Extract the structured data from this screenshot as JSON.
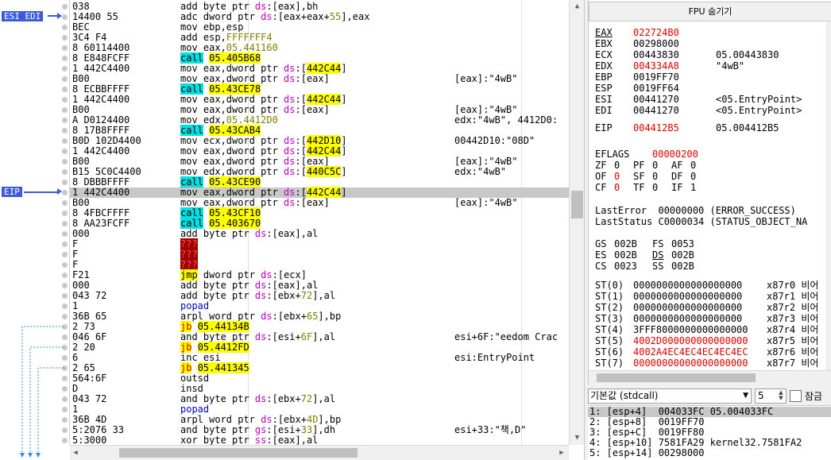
{
  "disasm": {
    "labels": {
      "esi_edi": "ESI EDI",
      "eip": "EIP"
    },
    "rows": [
      {
        "addr": "038",
        "ins": [
          [
            "mn",
            "add byte ptr "
          ],
          [
            "seg",
            "ds"
          ],
          [
            "mn",
            ":[eax],bh"
          ]
        ],
        "cmt": ""
      },
      {
        "addr": "14400 55",
        "ins": [
          [
            "mn",
            "adc dword ptr "
          ],
          [
            "seg",
            "ds"
          ],
          [
            "mn",
            ":[eax+eax+"
          ],
          [
            "num",
            "55"
          ],
          [
            "mn",
            "],eax"
          ]
        ],
        "cmt": ""
      },
      {
        "addr": "BEC",
        "ins": [
          [
            "mn",
            "mov ebp,esp"
          ]
        ],
        "cmt": ""
      },
      {
        "addr": "3C4 F4",
        "ins": [
          [
            "mn",
            "add esp,"
          ],
          [
            "num",
            "FFFFFFF4"
          ]
        ],
        "cmt": ""
      },
      {
        "addr": "8 60114400",
        "ins": [
          [
            "mn",
            "mov eax,"
          ],
          [
            "num",
            "05.441160"
          ]
        ],
        "cmt": ""
      },
      {
        "addr": "8 E848FCFF",
        "ins": [
          [
            "call",
            "call"
          ],
          [
            "mn",
            " "
          ],
          [
            "tgt",
            "05.405B68"
          ]
        ],
        "cmt": ""
      },
      {
        "addr": "1 442C4400",
        "ins": [
          [
            "mn",
            "mov eax,dword ptr "
          ],
          [
            "seg",
            "ds"
          ],
          [
            "mn",
            ":["
          ],
          [
            "tgt",
            "442C44"
          ],
          [
            "mn",
            "]"
          ]
        ],
        "cmt": ""
      },
      {
        "addr": "B00",
        "ins": [
          [
            "mn",
            "mov eax,dword ptr "
          ],
          [
            "seg",
            "ds"
          ],
          [
            "mn",
            ":[eax]"
          ]
        ],
        "cmt": "[eax]:\"4wB\""
      },
      {
        "addr": "8 ECBBFFFF",
        "ins": [
          [
            "call",
            "call"
          ],
          [
            "mn",
            " "
          ],
          [
            "tgt",
            "05.43CE78"
          ]
        ],
        "cmt": ""
      },
      {
        "addr": "1 442C4400",
        "ins": [
          [
            "mn",
            "mov eax,dword ptr "
          ],
          [
            "seg",
            "ds"
          ],
          [
            "mn",
            ":["
          ],
          [
            "tgt",
            "442C44"
          ],
          [
            "mn",
            "]"
          ]
        ],
        "cmt": ""
      },
      {
        "addr": "B00",
        "ins": [
          [
            "mn",
            "mov eax,dword ptr "
          ],
          [
            "seg",
            "ds"
          ],
          [
            "mn",
            ":[eax]"
          ]
        ],
        "cmt": "[eax]:\"4wB\""
      },
      {
        "addr": "A D0124400",
        "ins": [
          [
            "mn",
            "mov edx,"
          ],
          [
            "num",
            "05.4412D0"
          ]
        ],
        "cmt": "edx:\"4wB\", 4412D0:"
      },
      {
        "addr": "8 17B8FFFF",
        "ins": [
          [
            "call",
            "call"
          ],
          [
            "mn",
            " "
          ],
          [
            "tgt",
            "05.43CAB4"
          ]
        ],
        "cmt": ""
      },
      {
        "addr": "B0D 102D4400",
        "ins": [
          [
            "mn",
            "mov ecx,dword ptr "
          ],
          [
            "seg",
            "ds"
          ],
          [
            "mn",
            ":["
          ],
          [
            "tgt",
            "442D10"
          ],
          [
            "mn",
            "]"
          ]
        ],
        "cmt": "00442D10:\"08D\""
      },
      {
        "addr": "1 442C4400",
        "ins": [
          [
            "mn",
            "mov eax,dword ptr "
          ],
          [
            "seg",
            "ds"
          ],
          [
            "mn",
            ":["
          ],
          [
            "tgt",
            "442C44"
          ],
          [
            "mn",
            "]"
          ]
        ],
        "cmt": ""
      },
      {
        "addr": "B00",
        "ins": [
          [
            "mn",
            "mov eax,dword ptr "
          ],
          [
            "seg",
            "ds"
          ],
          [
            "mn",
            ":[eax]"
          ]
        ],
        "cmt": "[eax]:\"4wB\""
      },
      {
        "addr": "B15 5C0C4400",
        "ins": [
          [
            "mn",
            "mov edx,dword ptr "
          ],
          [
            "seg",
            "ds"
          ],
          [
            "mn",
            ":["
          ],
          [
            "tgt",
            "440C5C"
          ],
          [
            "mn",
            "]"
          ]
        ],
        "cmt": "edx:\"4wB\""
      },
      {
        "addr": "8 DBBBFFFF",
        "ins": [
          [
            "call",
            "call"
          ],
          [
            "mn",
            " "
          ],
          [
            "tgt",
            "05.43CE90"
          ]
        ],
        "cmt": ""
      },
      {
        "addr": "1 442C4400",
        "ins": [
          [
            "mn",
            "mov eax,dword ptr "
          ],
          [
            "seg",
            "ds"
          ],
          [
            "mn",
            ":["
          ],
          [
            "tgt",
            "442C44"
          ],
          [
            "mn",
            "]"
          ]
        ],
        "cmt": "",
        "eip": true
      },
      {
        "addr": "B00",
        "ins": [
          [
            "mn",
            "mov eax,dword ptr "
          ],
          [
            "seg",
            "ds"
          ],
          [
            "mn",
            ":[eax]"
          ]
        ],
        "cmt": "[eax]:\"4wB\""
      },
      {
        "addr": "8 4FBCFFFF",
        "ins": [
          [
            "call",
            "call"
          ],
          [
            "mn",
            " "
          ],
          [
            "tgt",
            "05.43CF10"
          ]
        ],
        "cmt": ""
      },
      {
        "addr": "8 AA23FCFF",
        "ins": [
          [
            "call",
            "call"
          ],
          [
            "mn",
            " "
          ],
          [
            "tgt",
            "05.403670"
          ]
        ],
        "cmt": ""
      },
      {
        "addr": "000",
        "ins": [
          [
            "mn",
            "add byte ptr "
          ],
          [
            "seg",
            "ds"
          ],
          [
            "mn",
            ":[eax],al"
          ]
        ],
        "cmt": ""
      },
      {
        "addr": "F",
        "ins": [
          [
            "bad",
            "???"
          ]
        ],
        "cmt": ""
      },
      {
        "addr": "F",
        "ins": [
          [
            "bad",
            "???"
          ]
        ],
        "cmt": ""
      },
      {
        "addr": "F",
        "ins": [
          [
            "bad",
            "???"
          ]
        ],
        "cmt": ""
      },
      {
        "addr": "F21",
        "ins": [
          [
            "jmp",
            "jmp"
          ],
          [
            "mn",
            " dword ptr "
          ],
          [
            "seg",
            "ds"
          ],
          [
            "mn",
            ":[ecx]"
          ]
        ],
        "cmt": ""
      },
      {
        "addr": "000",
        "ins": [
          [
            "mn",
            "add byte ptr "
          ],
          [
            "seg",
            "ds"
          ],
          [
            "mn",
            ":[eax],al"
          ]
        ],
        "cmt": ""
      },
      {
        "addr": "043 72",
        "ins": [
          [
            "mn",
            "add byte ptr "
          ],
          [
            "seg",
            "ds"
          ],
          [
            "mn",
            ":[ebx+"
          ],
          [
            "num",
            "72"
          ],
          [
            "mn",
            "],al"
          ]
        ],
        "cmt": ""
      },
      {
        "addr": "1",
        "ins": [
          [
            "mn-blue",
            "popad"
          ]
        ],
        "cmt": ""
      },
      {
        "addr": "36B 65",
        "ins": [
          [
            "mn",
            "arpl word ptr "
          ],
          [
            "seg",
            "ds"
          ],
          [
            "mn",
            ":[ebx+"
          ],
          [
            "num",
            "65"
          ],
          [
            "mn",
            "],bp"
          ]
        ],
        "cmt": ""
      },
      {
        "addr": "2 73",
        "ins": [
          [
            "jcc",
            "jb"
          ],
          [
            "mn",
            " "
          ],
          [
            "tgt",
            "05.44134B"
          ]
        ],
        "cmt": ""
      },
      {
        "addr": "046 6F",
        "ins": [
          [
            "mn",
            "and byte ptr "
          ],
          [
            "seg",
            "ds"
          ],
          [
            "mn",
            ":[esi+"
          ],
          [
            "num",
            "6F"
          ],
          [
            "mn",
            "],al"
          ]
        ],
        "cmt": "esi+6F:\"eedom Crac"
      },
      {
        "addr": "2 20",
        "ins": [
          [
            "jcc",
            "jb"
          ],
          [
            "mn",
            " "
          ],
          [
            "tgt",
            "05.4412FD"
          ]
        ],
        "cmt": ""
      },
      {
        "addr": "6",
        "ins": [
          [
            "mn",
            "inc esi"
          ]
        ],
        "cmt": "esi:EntryPoint"
      },
      {
        "addr": "2 65",
        "ins": [
          [
            "jcc",
            "jb"
          ],
          [
            "mn",
            " "
          ],
          [
            "tgt",
            "05.441345"
          ]
        ],
        "cmt": ""
      },
      {
        "addr": "564:6F",
        "ins": [
          [
            "mn",
            "outsd"
          ]
        ],
        "cmt": ""
      },
      {
        "addr": "D",
        "ins": [
          [
            "mn",
            "insd"
          ]
        ],
        "cmt": ""
      },
      {
        "addr": "043 72",
        "ins": [
          [
            "mn",
            "and byte ptr "
          ],
          [
            "seg",
            "ds"
          ],
          [
            "mn",
            ":[ebx+"
          ],
          [
            "num",
            "72"
          ],
          [
            "mn",
            "],al"
          ]
        ],
        "cmt": ""
      },
      {
        "addr": "1",
        "ins": [
          [
            "mn-blue",
            "popad"
          ]
        ],
        "cmt": ""
      },
      {
        "addr": "36B 4D",
        "ins": [
          [
            "mn",
            "arpl word ptr "
          ],
          [
            "seg",
            "ds"
          ],
          [
            "mn",
            ":[ebx+"
          ],
          [
            "num",
            "4D"
          ],
          [
            "mn",
            "],bp"
          ]
        ],
        "cmt": ""
      },
      {
        "addr": "5:2076 33",
        "ins": [
          [
            "mn",
            "and byte ptr "
          ],
          [
            "seg",
            "gs"
          ],
          [
            "mn",
            ":[esi+"
          ],
          [
            "num",
            "33"
          ],
          [
            "mn",
            "],dh"
          ]
        ],
        "cmt": "esi+33:\"책,D\""
      },
      {
        "addr": "5:3000",
        "ins": [
          [
            "mn",
            "xor byte ptr "
          ],
          [
            "seg",
            "ss"
          ],
          [
            "mn",
            ":[eax],al"
          ]
        ],
        "cmt": ""
      }
    ]
  },
  "registers": {
    "header": "FPU 숨기기",
    "gp": [
      {
        "name": "EAX",
        "value": "022724B0",
        "desc": "",
        "red": true
      },
      {
        "name": "EBX",
        "value": "00298000",
        "desc": "",
        "red": false
      },
      {
        "name": "ECX",
        "value": "00443830",
        "desc": "05.00443830",
        "red": false
      },
      {
        "name": "EDX",
        "value": "004334A8",
        "desc": "\"4wB\"",
        "red": true
      },
      {
        "name": "EBP",
        "value": "0019FF70",
        "desc": "",
        "red": false
      },
      {
        "name": "ESP",
        "value": "0019FF64",
        "desc": "",
        "red": false
      },
      {
        "name": "ESI",
        "value": "00441270",
        "desc": "<05.EntryPoint>",
        "red": false
      },
      {
        "name": "EDI",
        "value": "00441270",
        "desc": "<05.EntryPoint>",
        "red": false
      }
    ],
    "eip": {
      "name": "EIP",
      "value": "004412B5",
      "desc": "05.004412B5"
    },
    "eflags": {
      "name": "EFLAGS",
      "value": "00000200"
    },
    "flags_rows": [
      [
        [
          "ZF",
          "0"
        ],
        [
          "PF",
          "0"
        ],
        [
          "AF",
          "0"
        ]
      ],
      [
        [
          "OF",
          "0"
        ],
        [
          "SF",
          "0"
        ],
        [
          "DF",
          "0"
        ]
      ],
      [
        [
          "CF",
          "0"
        ],
        [
          "TF",
          "0"
        ],
        [
          "IF",
          "1"
        ]
      ]
    ],
    "last_error": "LastError  00000000 (ERROR_SUCCESS)",
    "last_status": "LastStatus C0000034 (STATUS_OBJECT_NA",
    "segs": [
      [
        [
          "GS",
          "002B"
        ],
        [
          "FS",
          "0053"
        ]
      ],
      [
        [
          "ES",
          "002B"
        ],
        [
          "DS",
          "002B"
        ]
      ],
      [
        [
          "CS",
          "0023"
        ],
        [
          "SS",
          "002B"
        ]
      ]
    ],
    "st": [
      {
        "name": "ST(0)",
        "value": "0000000000000000000",
        "tag": "x87r0 비어",
        "red": false
      },
      {
        "name": "ST(1)",
        "value": "0000000000000000000",
        "tag": "x87r1 비어",
        "red": false
      },
      {
        "name": "ST(2)",
        "value": "0000000000000000000",
        "tag": "x87r2 비어",
        "red": false
      },
      {
        "name": "ST(3)",
        "value": "0000000000000000000",
        "tag": "x87r3 비어",
        "red": false
      },
      {
        "name": "ST(4)",
        "value": "3FFF8000000000000000",
        "tag": "x87r4 비어",
        "red": false
      },
      {
        "name": "ST(5)",
        "value": "4002D000000000000000",
        "tag": "x87r5 비어",
        "red": true
      },
      {
        "name": "ST(6)",
        "value": "4002A4EC4EC4EC4EC4EC",
        "tag": "x87r6 비어",
        "red": true
      },
      {
        "name": "ST(7)",
        "value": "00000000000000000000",
        "tag": "x87r7 비어",
        "red": true
      }
    ]
  },
  "callconv": {
    "selected": "기본값 (stdcall)",
    "count": "5",
    "lock_label": "잠금"
  },
  "args": [
    "1: [esp+4]  004033FC 05.004033FC",
    "2: [esp+8]  0019FF70",
    "3: [esp+C]  0019FF80",
    "4: [esp+10] 7581FA29 kernel32.7581FA2",
    "5: [esp+14] 00298000"
  ],
  "colors": {
    "accent": "#3c5cdc",
    "changed": "#e00000",
    "call_bg": "#00e0e0",
    "jump_bg": "#ffff00"
  }
}
